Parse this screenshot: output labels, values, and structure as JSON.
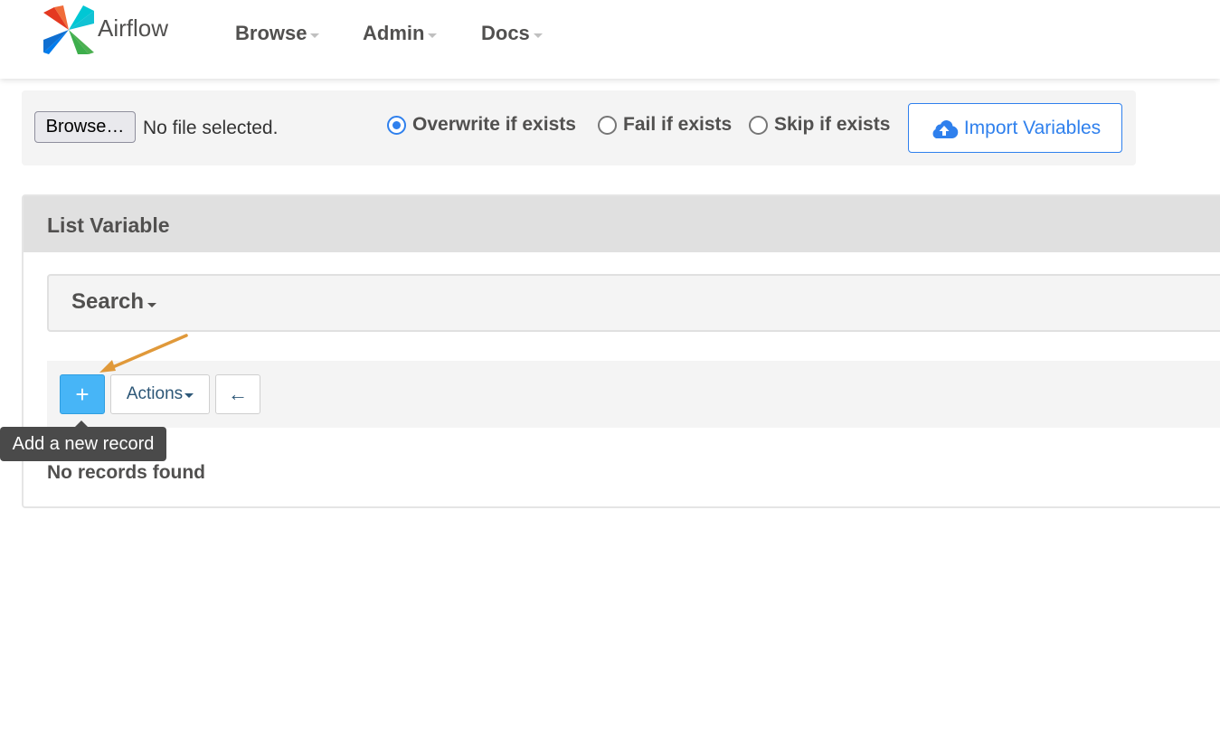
{
  "navbar": {
    "brand": "Airflow",
    "items": [
      {
        "label": "Browse"
      },
      {
        "label": "Admin"
      },
      {
        "label": "Docs"
      }
    ]
  },
  "import_bar": {
    "file_button": "Browse…",
    "file_status": "No file selected.",
    "options": [
      {
        "label": "Overwrite if exists",
        "checked": true
      },
      {
        "label": "Fail if exists",
        "checked": false
      },
      {
        "label": "Skip if exists",
        "checked": false
      }
    ],
    "import_button": "Import Variables"
  },
  "list": {
    "title": "List Variable",
    "search_label": "Search",
    "add_button": "+",
    "actions_button": "Actions",
    "back_button": "←",
    "empty_message": "No records found"
  },
  "tooltip": {
    "text": "Add a new record"
  },
  "colors": {
    "accent": "#2f80ed",
    "add_button": "#47b5f7",
    "annotation_arrow": "#e0993a"
  },
  "icons": {
    "logo": "airflow-pinwheel-icon",
    "import": "cloud-upload-icon",
    "back": "arrow-left-icon"
  }
}
